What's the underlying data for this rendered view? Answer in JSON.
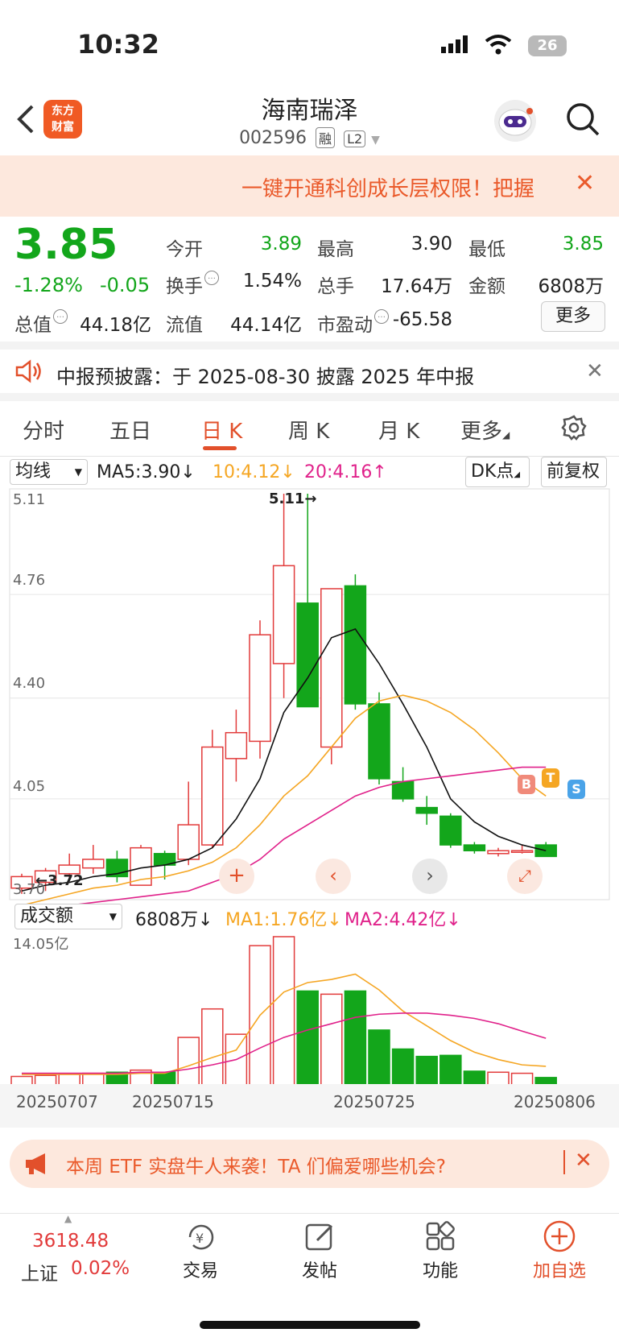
{
  "status_bar": {
    "time": "10:32",
    "battery": "26"
  },
  "header": {
    "logo": "东方\n财富",
    "title": "海南瑞泽",
    "code": "002596",
    "tags": [
      "融",
      "L2"
    ]
  },
  "promo": {
    "text": "一键开通科创成长层权限！把握",
    "close": "✕"
  },
  "quote": {
    "price": "3.85",
    "pct": "-1.28%",
    "change": "-0.05",
    "fields": [
      {
        "label": "今开",
        "value": "3.89",
        "color": "green"
      },
      {
        "label": "最高",
        "value": "3.90",
        "color": "black"
      },
      {
        "label": "最低",
        "value": "3.85",
        "color": "green"
      },
      {
        "label": "换手",
        "value": "1.54%",
        "color": "black"
      },
      {
        "label": "总手",
        "value": "17.64万",
        "color": "black"
      },
      {
        "label": "金额",
        "value": "6808万",
        "color": "black"
      },
      {
        "label": "总值",
        "value": "44.18亿",
        "color": "black"
      },
      {
        "label": "流值",
        "value": "44.14亿",
        "color": "black"
      },
      {
        "label": "市盈动",
        "value": "-65.58",
        "color": "black"
      }
    ],
    "more": "更多"
  },
  "notice": {
    "text": "中报预披露：于 2025-08-30 披露 2025 年中报",
    "close": "✕"
  },
  "tabs": [
    "分时",
    "五日",
    "日 K",
    "周 K",
    "月 K",
    "更多"
  ],
  "active_tab": "日 K",
  "ma_row": {
    "selector": "均线",
    "ma5": "MA5:3.90↓",
    "ma10": "10:4.12↓",
    "ma20": "20:4.16↑",
    "dk": "DK点",
    "fq": "前复权"
  },
  "chart_labels": {
    "price_ticks": [
      "5.11",
      "4.76",
      "4.40",
      "4.05",
      "3.70"
    ],
    "high_marker": "5.11→",
    "low_marker": "←3.72",
    "signals": [
      "B",
      "T",
      "S"
    ]
  },
  "vol_row": {
    "selector": "成交额",
    "value": "6808万↓",
    "ma1": "MA1:1.76亿↓",
    "ma2": "MA2:4.42亿↓",
    "top_tick": "14.05亿"
  },
  "dates": [
    "20250707",
    "20250715",
    "20250725",
    "20250806"
  ],
  "chart_data": {
    "type": "candlestick",
    "ylim": [
      3.7,
      5.11
    ],
    "candles": [
      {
        "o": 3.74,
        "c": 3.78,
        "h": 3.79,
        "l": 3.72
      },
      {
        "o": 3.76,
        "c": 3.8,
        "h": 3.81,
        "l": 3.73
      },
      {
        "o": 3.79,
        "c": 3.82,
        "h": 3.86,
        "l": 3.77
      },
      {
        "o": 3.81,
        "c": 3.84,
        "h": 3.89,
        "l": 3.79
      },
      {
        "o": 3.84,
        "c": 3.78,
        "h": 3.87,
        "l": 3.76
      },
      {
        "o": 3.75,
        "c": 3.88,
        "h": 3.89,
        "l": 3.75
      },
      {
        "o": 3.86,
        "c": 3.82,
        "h": 3.87,
        "l": 3.77
      },
      {
        "o": 3.84,
        "c": 3.96,
        "h": 4.11,
        "l": 3.82
      },
      {
        "o": 3.89,
        "c": 4.23,
        "h": 4.29,
        "l": 3.88
      },
      {
        "o": 4.19,
        "c": 4.28,
        "h": 4.36,
        "l": 4.11
      },
      {
        "o": 4.25,
        "c": 4.62,
        "h": 4.67,
        "l": 4.19
      },
      {
        "o": 4.52,
        "c": 4.86,
        "h": 5.11,
        "l": 4.4
      },
      {
        "o": 4.73,
        "c": 4.37,
        "h": 5.11,
        "l": 4.37
      },
      {
        "o": 4.23,
        "c": 4.78,
        "h": 4.78,
        "l": 4.17
      },
      {
        "o": 4.79,
        "c": 4.38,
        "h": 4.83,
        "l": 4.36
      },
      {
        "o": 4.38,
        "c": 4.12,
        "h": 4.42,
        "l": 4.1
      },
      {
        "o": 4.11,
        "c": 4.05,
        "h": 4.16,
        "l": 4.04
      },
      {
        "o": 4.02,
        "c": 4.0,
        "h": 4.06,
        "l": 3.96
      },
      {
        "o": 3.99,
        "c": 3.89,
        "h": 4.0,
        "l": 3.88
      },
      {
        "o": 3.89,
        "c": 3.87,
        "h": 3.9,
        "l": 3.86
      },
      {
        "o": 3.86,
        "c": 3.87,
        "h": 3.88,
        "l": 3.85
      },
      {
        "o": 3.87,
        "c": 3.87,
        "h": 3.89,
        "l": 3.86
      },
      {
        "o": 3.89,
        "c": 3.85,
        "h": 3.9,
        "l": 3.85
      }
    ],
    "ma5": [
      3.73,
      3.75,
      3.76,
      3.78,
      3.79,
      3.81,
      3.82,
      3.84,
      3.88,
      3.98,
      4.12,
      4.35,
      4.47,
      4.61,
      4.64,
      4.52,
      4.38,
      4.23,
      4.05,
      3.97,
      3.92,
      3.89,
      3.87
    ],
    "ma10": [
      3.68,
      3.7,
      3.72,
      3.74,
      3.75,
      3.77,
      3.78,
      3.8,
      3.83,
      3.88,
      3.96,
      4.06,
      4.13,
      4.23,
      4.33,
      4.39,
      4.41,
      4.39,
      4.35,
      4.29,
      4.21,
      4.12,
      4.06
    ],
    "ma20": [
      3.66,
      3.67,
      3.68,
      3.69,
      3.7,
      3.71,
      3.72,
      3.73,
      3.76,
      3.79,
      3.84,
      3.91,
      3.96,
      4.01,
      4.06,
      4.09,
      4.11,
      4.12,
      4.13,
      4.14,
      4.15,
      4.16,
      4.16
    ],
    "volumes": [
      0.8,
      0.9,
      1.0,
      1.1,
      1.2,
      1.4,
      1.2,
      4.5,
      7.2,
      4.8,
      13.2,
      14.05,
      8.9,
      8.6,
      8.9,
      5.2,
      3.4,
      2.7,
      2.8,
      1.3,
      1.2,
      1.1,
      0.7
    ],
    "vol_ma1": [
      1.0,
      1.0,
      1.0,
      1.0,
      1.0,
      1.1,
      1.1,
      1.8,
      2.6,
      3.3,
      6.6,
      8.8,
      9.7,
      10.0,
      10.5,
      9.0,
      7.0,
      5.6,
      4.2,
      3.1,
      2.4,
      1.9,
      1.76
    ],
    "vol_ma2": [
      1.1,
      1.1,
      1.1,
      1.1,
      1.1,
      1.2,
      1.2,
      1.5,
      1.9,
      2.4,
      3.5,
      4.5,
      5.2,
      5.8,
      6.4,
      6.7,
      6.8,
      6.8,
      6.6,
      6.3,
      5.8,
      5.1,
      4.42
    ],
    "vol_ylim": [
      0,
      14.05
    ]
  },
  "bottom_banner": {
    "text": "本周 ETF 实盘牛人来袭！TA 们偏爱哪些机会?",
    "close": "✕"
  },
  "tabbar": {
    "index_value": "3618.48",
    "index_name": "上证",
    "index_pct": "0.02%",
    "items": [
      "交易",
      "发帖",
      "功能",
      "加自选"
    ]
  }
}
